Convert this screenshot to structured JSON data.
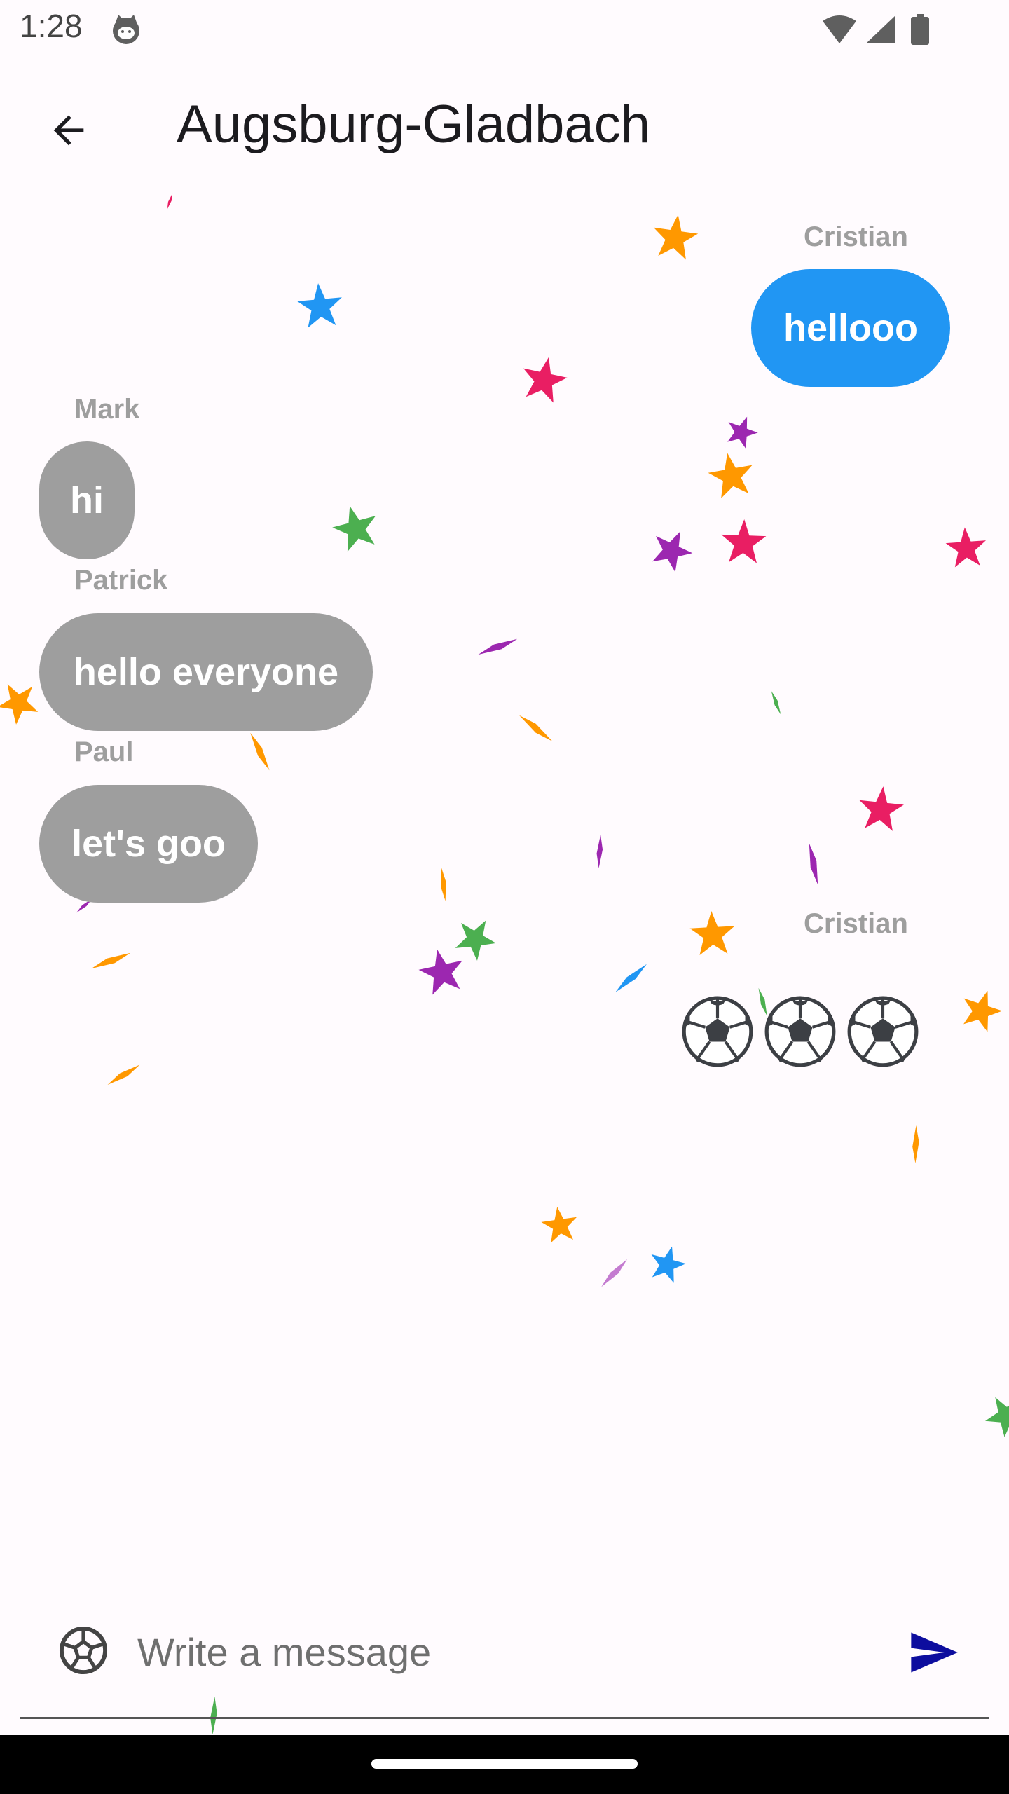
{
  "status_bar": {
    "time": "1:28",
    "icons": [
      "cat-notification-icon",
      "wifi-icon",
      "cellular-signal-icon",
      "battery-icon"
    ]
  },
  "app_bar": {
    "back_icon": "arrow-back-icon",
    "title": "Augsburg-Gladbach"
  },
  "messages": [
    {
      "sender": "Cristian",
      "text": "hellooo",
      "mine": true
    },
    {
      "sender": "Mark",
      "text": "hi",
      "mine": false
    },
    {
      "sender": "Patrick",
      "text": "hello everyone",
      "mine": false
    },
    {
      "sender": "Paul",
      "text": "let's goo",
      "mine": false
    },
    {
      "sender": "Cristian",
      "text": "⚽⚽⚽",
      "mine": true,
      "emoji_only": true
    }
  ],
  "composer": {
    "emoji_icon": "soccer-ball-icon",
    "placeholder": "Write a message",
    "value": "",
    "send_icon": "send-icon"
  },
  "colors": {
    "own_bubble": "#2196f3",
    "other_bubble": "#9e9e9e",
    "send_icon": "#0d0d9e",
    "background": "#fffbfe"
  },
  "confetti_colors": [
    "#ff9800",
    "#e91e63",
    "#9c27b0",
    "#4caf50",
    "#2196f3"
  ]
}
